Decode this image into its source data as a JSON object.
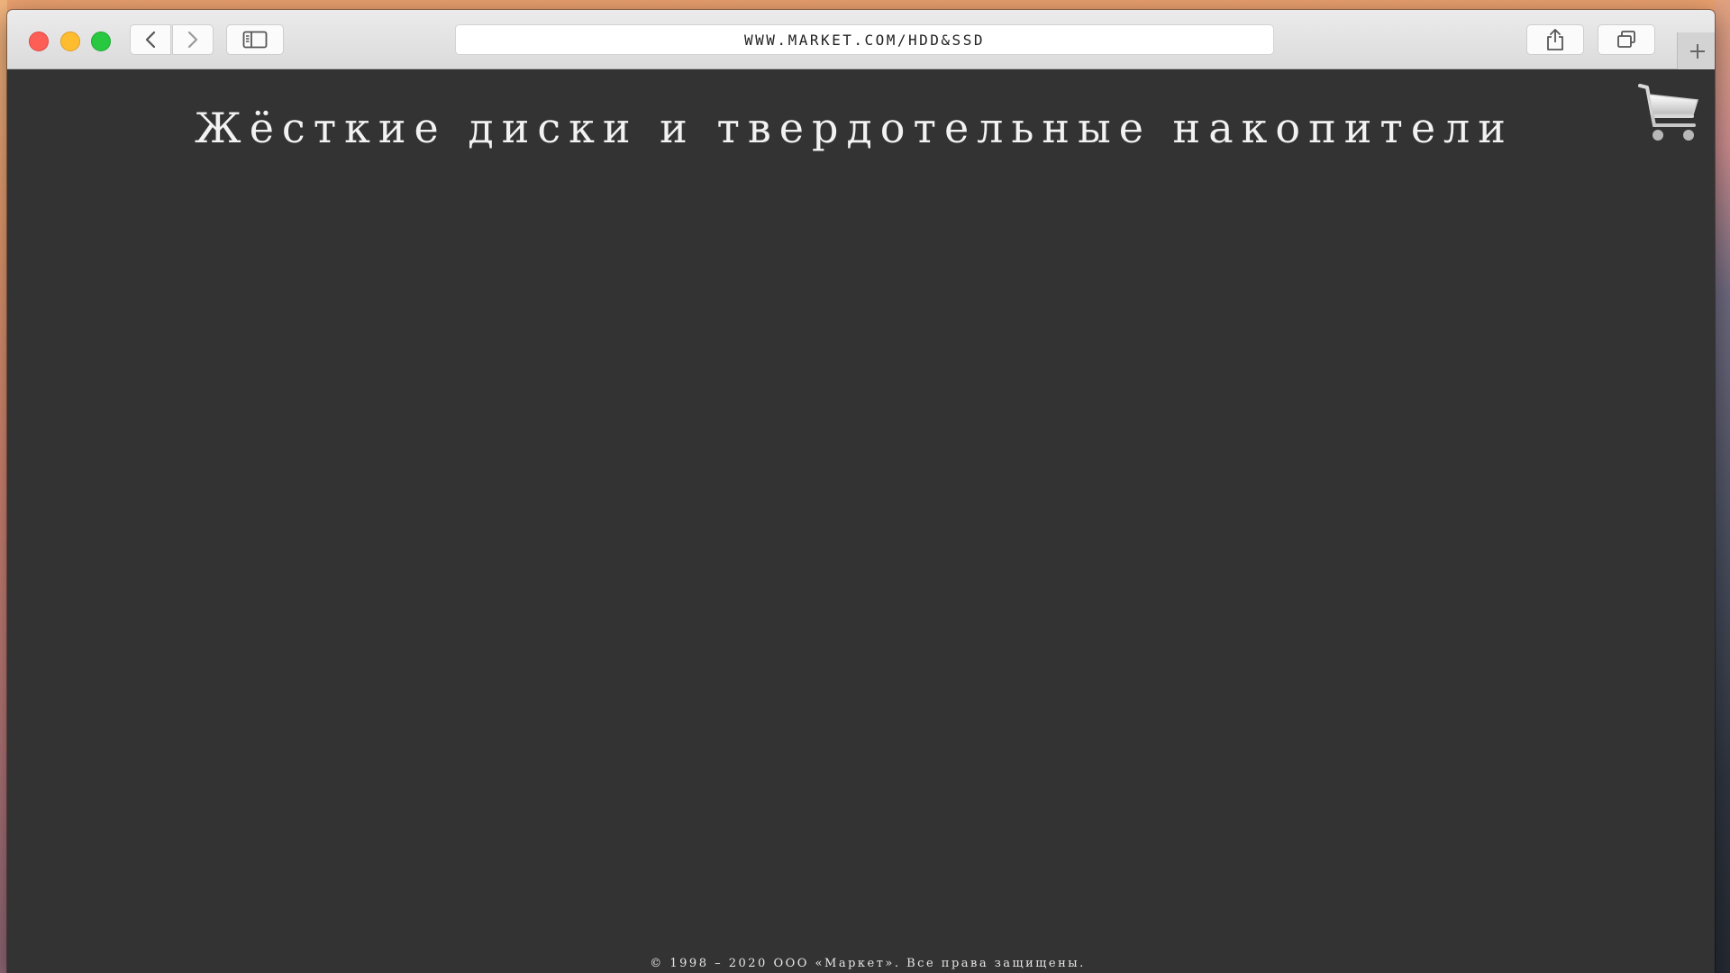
{
  "browser": {
    "url": "WWW.MARKET.COM/HDD&SSD"
  },
  "page": {
    "title": "Жёсткие диски и твердотельные накопители",
    "footer": "© 1998 – 2020 ООО «Маркет». Все права защищены."
  },
  "icons": {
    "back": "chevron-left-icon",
    "forward": "chevron-right-icon",
    "sidebar": "sidebar-icon",
    "share": "share-icon",
    "tabs": "tabs-overview-icon",
    "new_tab": "plus-icon",
    "cart": "shopping-cart-icon"
  },
  "colors": {
    "page_background": "#333333",
    "title_text": "#f2f2f2",
    "close": "#fd5f57",
    "minimize": "#febc2e",
    "zoom": "#28c840"
  }
}
